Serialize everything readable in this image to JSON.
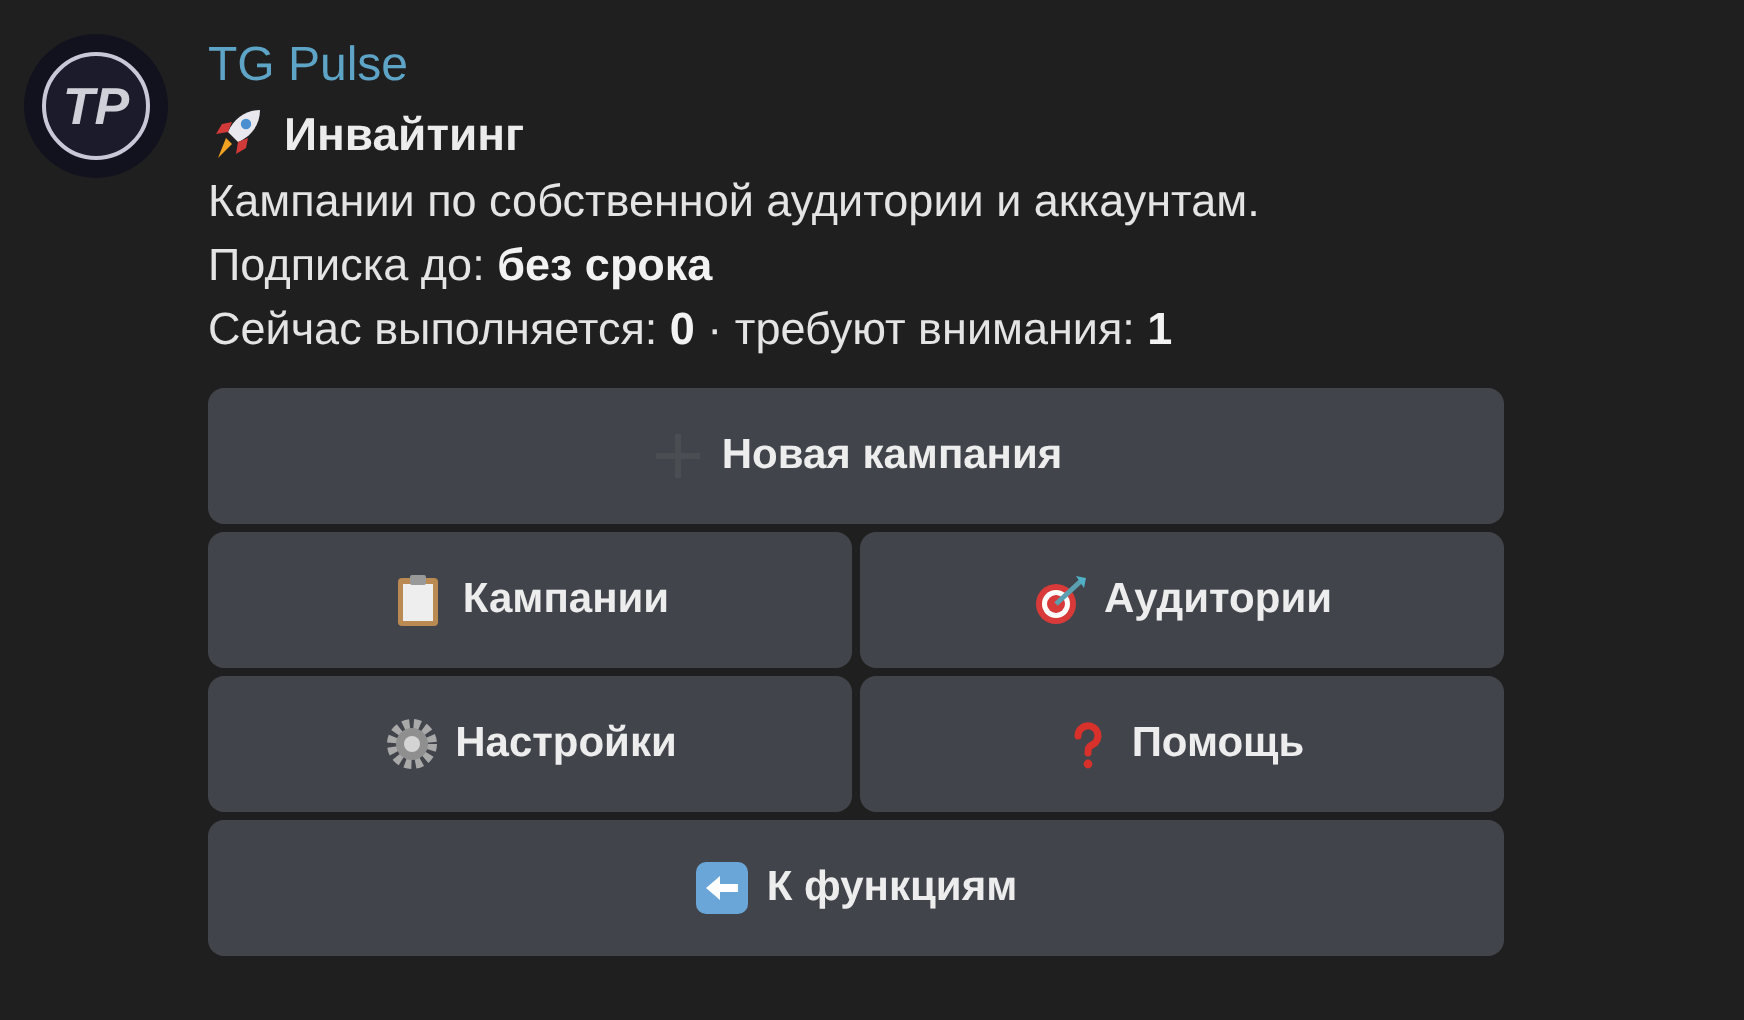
{
  "message": {
    "avatar_text": "TP",
    "sender": "TG Pulse",
    "title": "Инвайтинг",
    "lines": [
      "Кампании по собственной аудитории и аккаунтам.",
      "Подписка до: **без срока**",
      "Сейчас выполняется: **0** · требуют внимания: **1**"
    ]
  },
  "keyboard": [
    [
      {
        "label": "Новая кампания"
      }
    ],
    [
      {
        "label": "Кампании"
      },
      {
        "label": "Аудитории"
      }
    ],
    [
      {
        "label": "Настройки"
      },
      {
        "label": "Помощь"
      }
    ],
    [
      {
        "label": "К функциям"
      }
    ]
  ]
}
